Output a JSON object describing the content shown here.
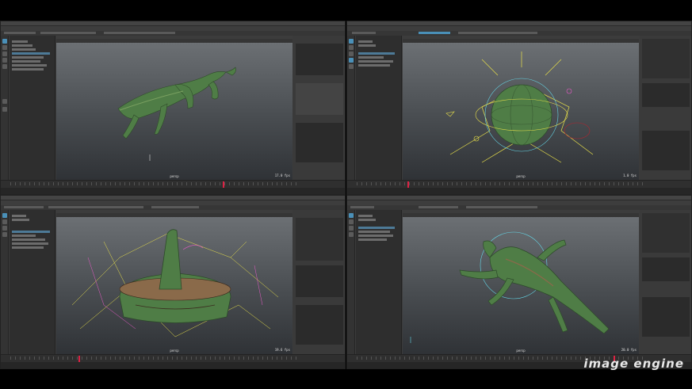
{
  "colors": {
    "background": "#000000",
    "maya_panel": "#3b3b3b",
    "viewport_top": "#6f7377",
    "viewport_bottom": "#2f3236",
    "creature_green": "#4f7d46",
    "rig_yellow": "#e8e04a",
    "rig_cyan": "#64d6e6",
    "selection_blue": "#4a90b8",
    "timeline_cursor": "#dd2244"
  },
  "panes": [
    {
      "id": "lizard-walk",
      "viewport_label": "persp",
      "fps": "17.0 fps"
    },
    {
      "id": "ball-rig",
      "viewport_label": "persp",
      "fps": "1.0 fps"
    },
    {
      "id": "shell-unfold",
      "viewport_label": "persp",
      "fps": "19.6 fps"
    },
    {
      "id": "frog-rig",
      "viewport_label": "persp",
      "fps": "20.0 fps"
    }
  ],
  "watermark": {
    "text": "image engine"
  }
}
